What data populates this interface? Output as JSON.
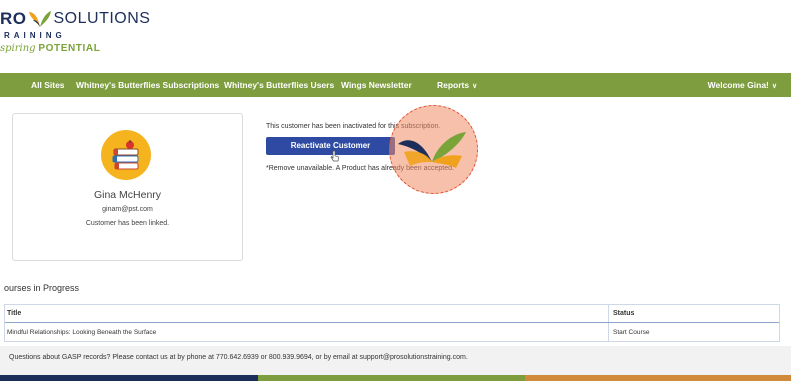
{
  "logo": {
    "pro": "RO",
    "solutions": "SOLUTIONS",
    "training": "RAINING",
    "tagline_script": "spiring",
    "tagline_bold": "POTENTIAL"
  },
  "nav": {
    "items": [
      "All Sites",
      "Whitney's Butterflies Subscriptions",
      "Whitney's Butterflies Users",
      "Wings Newsletter",
      "Reports"
    ],
    "welcome": "Welcome Gina!"
  },
  "profile": {
    "name": "Gina McHenry",
    "email": "ginam@pst.com",
    "status": "Customer has been linked."
  },
  "subscription": {
    "inactive_message": "This customer has been inactivated for this subscription.",
    "reactivate_label": "Reactivate Customer",
    "remove_message": "*Remove unavailable. A Product has already been accepted."
  },
  "courses": {
    "title": "ourses in Progress",
    "headers": {
      "title": "Title",
      "status": "Status"
    },
    "rows": [
      {
        "title": "Mindful Relationships: Looking Beneath the Surface",
        "status": "Start Course"
      }
    ]
  },
  "footer": {
    "contact": "Questions about GASP records? Please contact us at by phone at 770.642.6939 or 800.939.9694, or by email at support@prosolutionstraining.com."
  },
  "colors": {
    "nav": "#7d9d3f",
    "button": "#2e4aa3",
    "avatar": "#f5b41e",
    "stripe_navy": "#1c2f5b",
    "stripe_green": "#7d9d3f",
    "stripe_orange": "#d08a3a"
  }
}
